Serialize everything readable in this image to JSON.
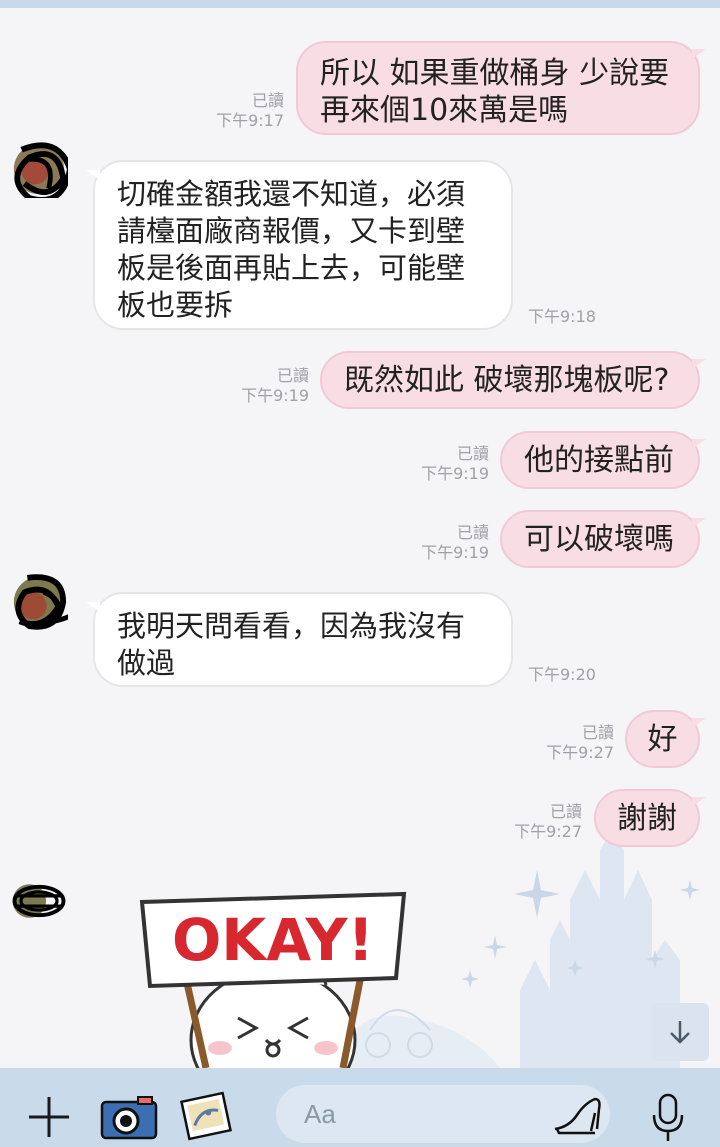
{
  "chat": {
    "messages": [
      {
        "side": "out",
        "lines": [
          "所以 如果重做桶身 少說要",
          "再來個10來萬是嗎"
        ],
        "read": "已讀",
        "time": "下午9:17"
      },
      {
        "side": "in",
        "lines": [
          "切確金額我還不知道，必須",
          "請檯面廠商報價，又卡到壁",
          "板是後面再貼上去，可能壁",
          "板也要拆"
        ],
        "time": "下午9:18"
      },
      {
        "side": "out",
        "lines": [
          "既然如此 破壞那塊板呢?"
        ],
        "read": "已讀",
        "time": "下午9:19"
      },
      {
        "side": "out",
        "lines": [
          "他的接點前"
        ],
        "read": "已讀",
        "time": "下午9:19"
      },
      {
        "side": "out",
        "lines": [
          "可以破壞嗎"
        ],
        "read": "已讀",
        "time": "下午9:19"
      },
      {
        "side": "in",
        "lines": [
          "我明天問看看，因為我沒有",
          "做過"
        ],
        "time": "下午9:20"
      },
      {
        "side": "out",
        "lines": [
          "好"
        ],
        "read": "已讀",
        "time": "下午9:27"
      },
      {
        "side": "out",
        "lines": [
          "謝謝"
        ],
        "read": "已讀",
        "time": "下午9:27"
      }
    ],
    "sticker": {
      "text": "OKAY!"
    }
  },
  "input": {
    "placeholder": "Aa"
  },
  "icons": {
    "add": "plus-icon",
    "camera": "camera-icon",
    "gallery": "photo-icon",
    "sticker": "glass-slipper-icon",
    "voice": "microphone-icon",
    "scroll": "arrow-down-icon"
  },
  "colors": {
    "outgoing_bubble": "#f9dde5",
    "incoming_bubble": "#ffffff",
    "bottom_bar": "#c9daeb",
    "background": "#f5f5f7",
    "sticker_red": "#d7282f"
  }
}
